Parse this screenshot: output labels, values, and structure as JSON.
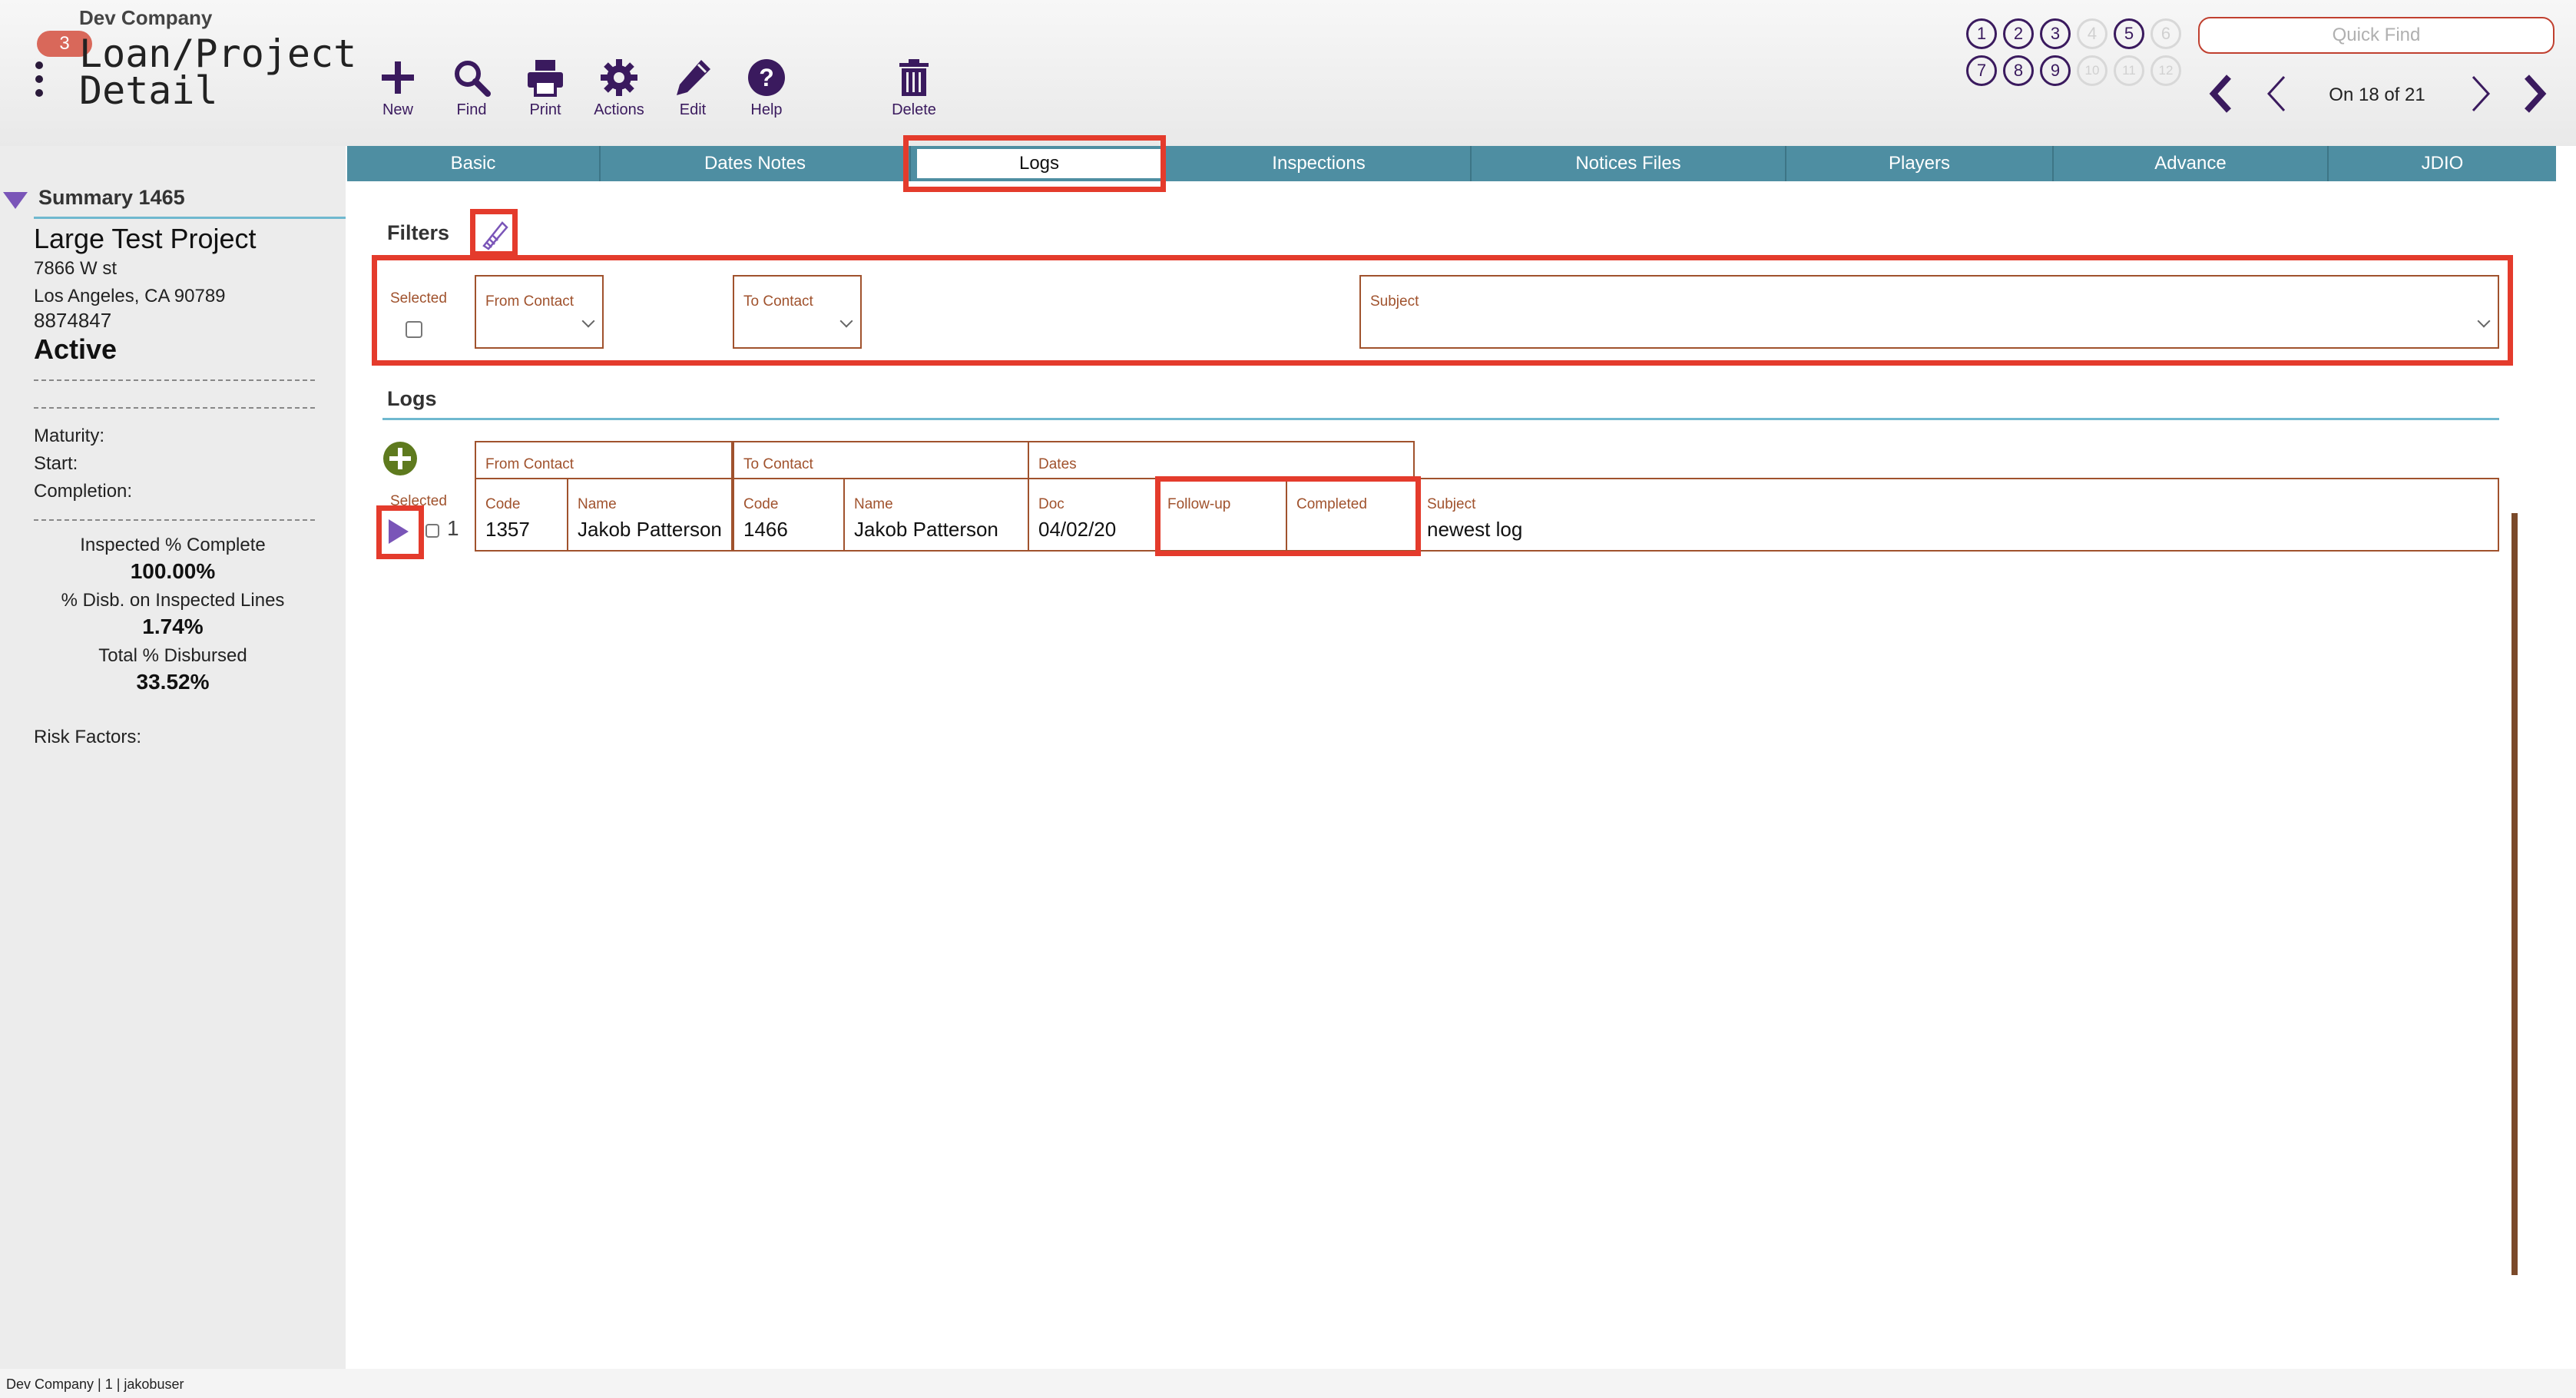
{
  "header": {
    "company": "Dev Company",
    "badge": "3",
    "title": "Loan/Project Detail",
    "toolbar": [
      {
        "label": "New",
        "icon": "plus-icon"
      },
      {
        "label": "Find",
        "icon": "search-icon"
      },
      {
        "label": "Print",
        "icon": "printer-icon"
      },
      {
        "label": "Actions",
        "icon": "gear-icon"
      },
      {
        "label": "Edit",
        "icon": "pencil-icon"
      },
      {
        "label": "Help",
        "icon": "help-icon"
      },
      {
        "label": "Delete",
        "icon": "trash-icon"
      }
    ],
    "windows": [
      {
        "num": "1",
        "active": true
      },
      {
        "num": "2",
        "active": true
      },
      {
        "num": "3",
        "active": true
      },
      {
        "num": "4",
        "active": false
      },
      {
        "num": "5",
        "active": true
      },
      {
        "num": "6",
        "active": false
      },
      {
        "num": "7",
        "active": true
      },
      {
        "num": "8",
        "active": true
      },
      {
        "num": "9",
        "active": true
      },
      {
        "num": "10",
        "active": false
      },
      {
        "num": "11",
        "active": false
      },
      {
        "num": "12",
        "active": false
      }
    ],
    "quick_find_placeholder": "Quick Find",
    "record_nav": "On 18 of 21"
  },
  "sidebar": {
    "summary_label": "Summary 1465",
    "project_name": "Large Test Project",
    "address1": "7866 W st",
    "address2": "Los Angeles, CA  90789",
    "phone": "8874847",
    "status": "Active",
    "maturity_label": "Maturity:",
    "start_label": "Start:",
    "completion_label": "Completion:",
    "inspected_label": "Inspected % Complete",
    "inspected_value": "100.00%",
    "disb_label": "% Disb. on Inspected Lines",
    "disb_value": "1.74%",
    "total_label": "Total % Disbursed",
    "total_value": "33.52%",
    "risk_label": "Risk Factors:"
  },
  "tabs": [
    "Basic",
    "Dates Notes",
    "Logs",
    "Inspections",
    "Notices Files",
    "Players",
    "Advance",
    "JDIO"
  ],
  "active_tab": "Logs",
  "filters": {
    "title": "Filters",
    "selected_label": "Selected",
    "from_contact_label": "From Contact",
    "to_contact_label": "To Contact",
    "subject_label": "Subject"
  },
  "logs": {
    "title": "Logs",
    "selected_label": "Selected",
    "groups": {
      "from_contact": "From Contact",
      "to_contact": "To Contact",
      "dates": "Dates"
    },
    "columns": {
      "from_code": "Code",
      "from_name": "Name",
      "to_code": "Code",
      "to_name": "Name",
      "doc": "Doc",
      "followup": "Follow-up",
      "completed": "Completed",
      "subject": "Subject"
    },
    "rows": [
      {
        "index": "1",
        "from_code": "1357",
        "from_name": "Jakob Patterson",
        "to_code": "1466",
        "to_name": "Jakob Patterson",
        "doc": "04/02/20",
        "followup": "",
        "completed": "",
        "subject": "newest log"
      }
    ]
  },
  "footer": "Dev Company | 1 | jakobuser",
  "colors": {
    "accent": "#3a1a5e",
    "tab_bar": "#4e8ea2",
    "highlight": "#e43b2c",
    "field_border": "#a0522d",
    "add_button": "#5e7a1e"
  }
}
